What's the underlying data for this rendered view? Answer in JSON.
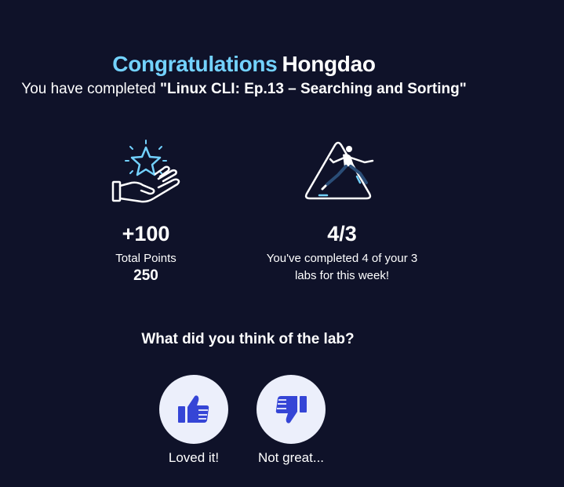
{
  "header": {
    "congrats_word": "Congratulations",
    "user_name": "Hongdao",
    "completed_prefix": "You have completed",
    "lab_name": "\"Linux CLI: Ep.13 – Searching and Sorting\""
  },
  "points": {
    "icon": "hand-star-icon",
    "gained": "+100",
    "label": "Total Points",
    "total": "250"
  },
  "weekly": {
    "icon": "runner-triangle-icon",
    "ratio": "4/3",
    "line1": "You've completed 4 of your 3",
    "line2": "labs for this week!"
  },
  "feedback": {
    "question": "What did you think of the lab?",
    "like_label": "Loved it!",
    "like_icon": "thumbs-up-icon",
    "dislike_label": "Not great...",
    "dislike_icon": "thumbs-down-icon"
  },
  "colors": {
    "background": "#0f1229",
    "accent": "#73d2ff",
    "thumb": "#3545d6",
    "button_bg": "#eceffb"
  }
}
